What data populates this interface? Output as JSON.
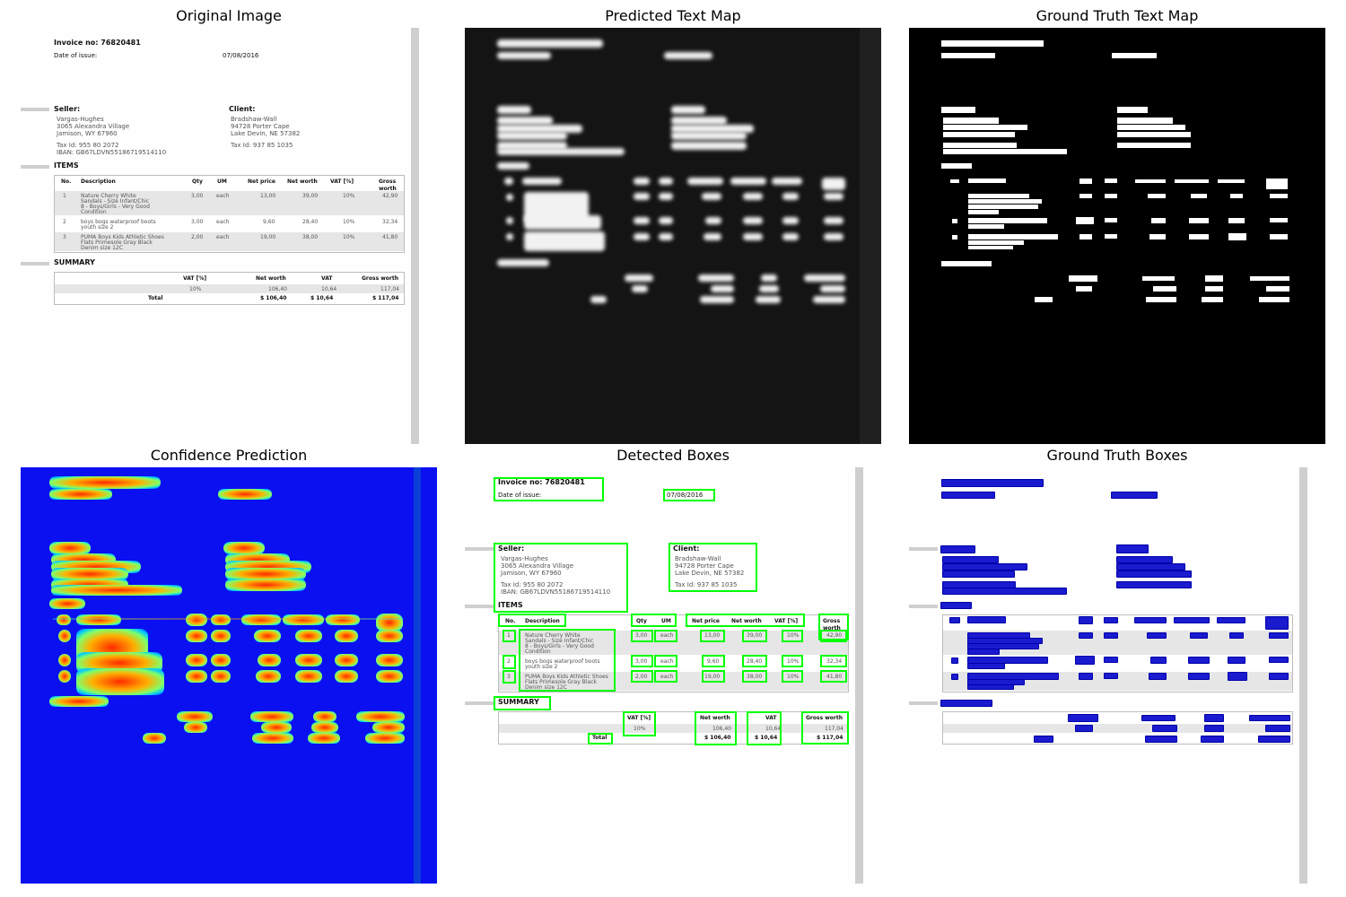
{
  "titles": {
    "original": "Original Image",
    "pred_map": "Predicted Text Map",
    "gt_map": "Ground Truth Text Map",
    "confidence": "Confidence Prediction",
    "detected": "Detected Boxes",
    "gt_boxes": "Ground Truth Boxes"
  },
  "invoice": {
    "invoice_no": "Invoice no: 76820481",
    "date_label": "Date of issue:",
    "date_value": "07/08/2016",
    "seller_label": "Seller:",
    "seller_name": "Vargas-Hughes",
    "seller_addr1": "3065 Alexandra Village",
    "seller_addr2": "Jamison, WY 67960",
    "seller_tax": "Tax Id: 955 80 2072",
    "seller_iban": "IBAN: GB67LDVN55186719514110",
    "client_label": "Client:",
    "client_name": "Bradshaw-Wall",
    "client_addr1": "94728 Porter Cape",
    "client_addr2": "Lake Devin, NE 57382",
    "client_tax": "Tax Id: 937 85 1035",
    "items_label": "ITEMS",
    "items_headers": [
      "No.",
      "Description",
      "Qty",
      "UM",
      "Net price",
      "Net worth",
      "VAT [%]",
      "Gross worth"
    ],
    "items": [
      {
        "no": "1",
        "desc1": "Nature Cherry White",
        "desc2": "Sandals - Size Infant/Chic",
        "desc3": "8 - Boys/Girls - Very Good",
        "desc4": "Condition",
        "qty": "3,00",
        "um": "each",
        "net_price": "13,00",
        "net_worth": "39,00",
        "vat": "10%",
        "gross": "42,90"
      },
      {
        "no": "2",
        "desc1": "boys bogs waterproof boots",
        "desc2": "youth size 2",
        "desc3": "",
        "desc4": "",
        "qty": "3,00",
        "um": "each",
        "net_price": "9,60",
        "net_worth": "28,40",
        "vat": "10%",
        "gross": "32,34"
      },
      {
        "no": "3",
        "desc1": "PUMA Boys Kids Athletic Shoes",
        "desc2": "Flats Primesole Gray Black",
        "desc3": "Denim size 12C",
        "desc4": "",
        "qty": "2,00",
        "um": "each",
        "net_price": "19,00",
        "net_worth": "38,00",
        "vat": "10%",
        "gross": "41,80"
      }
    ],
    "summary_label": "SUMMARY",
    "summary_headers": [
      "VAT [%]",
      "Net worth",
      "VAT",
      "Gross worth"
    ],
    "summary_row": [
      "10%",
      "106,40",
      "10,64",
      "117,04"
    ],
    "total_label": "Total",
    "total_row": [
      "$ 106,40",
      "$ 10,64",
      "$ 117,04"
    ]
  },
  "colors": {
    "detected_box": "#00ff00",
    "gt_box": "#1a1acf",
    "confidence_bg": "#0a10f0",
    "heat_core": "#ff2a00"
  }
}
